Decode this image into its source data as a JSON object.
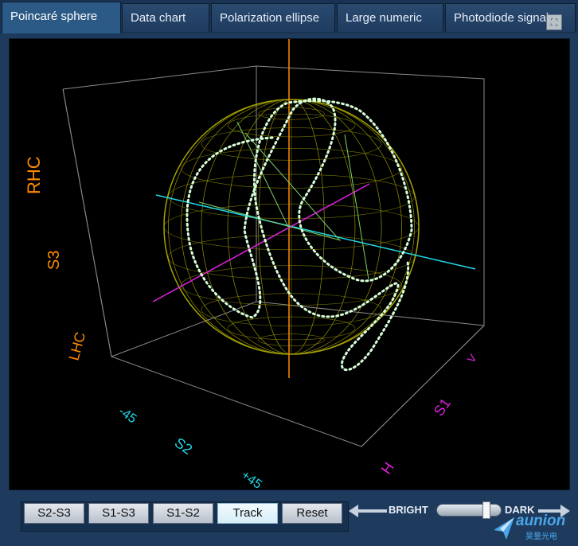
{
  "tabs": [
    {
      "label": "Poincaré sphere",
      "active": true
    },
    {
      "label": "Data chart",
      "active": false
    },
    {
      "label": "Polarization ellipse",
      "active": false
    },
    {
      "label": "Large numeric",
      "active": false
    },
    {
      "label": "Photodiode signal",
      "active": false
    }
  ],
  "icons": {
    "expand": "expand-icon",
    "logo": "aunion-logo-icon"
  },
  "plot": {
    "labels": {
      "rhc": "RHC",
      "s3": "S3",
      "lhc": "LHC",
      "m45": "-45",
      "s2": "S2",
      "p45": "+45",
      "v": "V",
      "s1": "S1",
      "h": "H"
    },
    "colors": {
      "s3_axis": "#ff8a00",
      "s2_axis": "#20d8e8",
      "s1_axis": "#e020e0",
      "sphere_mesh": "#a6a400",
      "trace": "#d8ffd8",
      "box": "#8a8a8a"
    }
  },
  "buttons": [
    {
      "label": "S2-S3",
      "active": false
    },
    {
      "label": "S1-S3",
      "active": false
    },
    {
      "label": "S1-S2",
      "active": false
    },
    {
      "label": "Track",
      "active": true
    },
    {
      "label": "Reset",
      "active": false
    }
  ],
  "brightness": {
    "bright_label": "BRIGHT",
    "dark_label": "DARK",
    "level": 0.82
  },
  "logo": {
    "name": "aunion",
    "subtitle": "昊量光电"
  }
}
